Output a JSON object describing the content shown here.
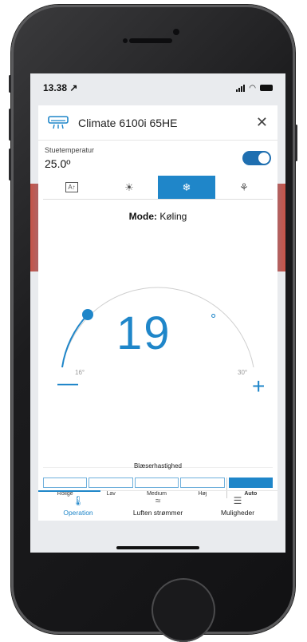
{
  "status": {
    "time": "13.38 ↗"
  },
  "device": {
    "name": "Climate 6100i 65HE"
  },
  "room": {
    "label": "Stuetemperatur",
    "value": "25.0º"
  },
  "power": {
    "on": true
  },
  "modes": [
    {
      "icon": "auto-icon",
      "glyph": "A↑"
    },
    {
      "icon": "sun-icon",
      "glyph": "☀"
    },
    {
      "icon": "snowflake-icon",
      "glyph": "❄",
      "active": true
    },
    {
      "icon": "fan-icon",
      "glyph": "⚘"
    }
  ],
  "mode_label": {
    "prefix": "Mode:",
    "value": "Køling"
  },
  "setpoint": {
    "value": "19",
    "unit": "°",
    "min_label": "16°",
    "max_label": "30°",
    "min": 16,
    "max": 30
  },
  "fan": {
    "title": "Blæserhastighed",
    "levels": [
      "Rolige",
      "Lav",
      "Medium",
      "Høj",
      "Auto"
    ],
    "selected": "Auto"
  },
  "tabs": [
    {
      "label": "Operation",
      "icon": "thermometer-icon",
      "glyph": "🌡",
      "active": true
    },
    {
      "label": "Luften strømmer",
      "icon": "airflow-icon",
      "glyph": "≈"
    },
    {
      "label": "Muligheder",
      "icon": "list-icon",
      "glyph": "☰"
    }
  ],
  "colors": {
    "accent": "#1f86c9",
    "toggle": "#1f6fb0"
  }
}
